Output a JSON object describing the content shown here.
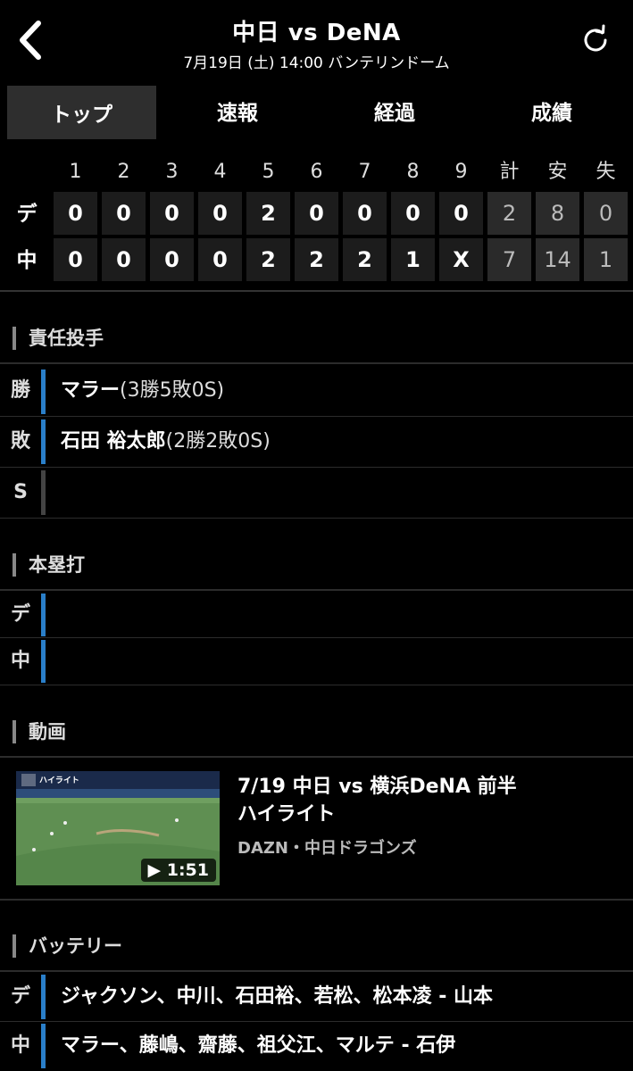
{
  "header": {
    "title": "中日 vs DeNA",
    "subtitle": "7月19日 (土) 14:00 バンテリンドーム",
    "back_icon": "chevron-left-icon",
    "refresh_icon": "refresh-icon"
  },
  "tabs": [
    "トップ",
    "速報",
    "経過",
    "成績"
  ],
  "scoreboard": {
    "headers": [
      "1",
      "2",
      "3",
      "4",
      "5",
      "6",
      "7",
      "8",
      "9",
      "計",
      "安",
      "失"
    ],
    "teams": [
      {
        "label": "デ",
        "scores": [
          "0",
          "0",
          "0",
          "0",
          "2",
          "0",
          "0",
          "0",
          "0"
        ],
        "totals": [
          "2",
          "8",
          "0"
        ]
      },
      {
        "label": "中",
        "scores": [
          "0",
          "0",
          "0",
          "0",
          "2",
          "2",
          "2",
          "1",
          "X"
        ],
        "totals": [
          "7",
          "14",
          "1"
        ]
      }
    ]
  },
  "pitchers": {
    "title": "責任投手",
    "rows": [
      {
        "label": "勝",
        "name": "マラー",
        "record": "(3勝5敗0S)"
      },
      {
        "label": "敗",
        "name": "石田 裕太郎",
        "record": "(2勝2敗0S)"
      },
      {
        "label": "S",
        "name": "",
        "record": ""
      }
    ]
  },
  "homeruns": {
    "title": "本塁打",
    "rows": [
      {
        "label": "デ",
        "text": ""
      },
      {
        "label": "中",
        "text": ""
      }
    ]
  },
  "video": {
    "title": "動画",
    "item_title": "7/19 中日 vs 横浜DeNA  前半ハイライト",
    "item_title_line1": "7/19 中日 vs 横浜DeNA  前半",
    "item_title_line2": "ハイライト",
    "source": "DAZN・中日ドラゴンズ",
    "duration": "▶ 1:51",
    "thumb_text": "ハイライト"
  },
  "battery": {
    "title": "バッテリー",
    "rows": [
      {
        "label": "デ",
        "text": "ジャクソン、中川、石田裕、若松、松本凌 - 山本"
      },
      {
        "label": "中",
        "text": "マラー、藤嶋、齋藤、祖父江、マルテ - 石伊"
      }
    ]
  },
  "colors": {
    "accent_bar": "#2a7fc9",
    "background": "#000000",
    "cell": "#1c1c1c"
  }
}
